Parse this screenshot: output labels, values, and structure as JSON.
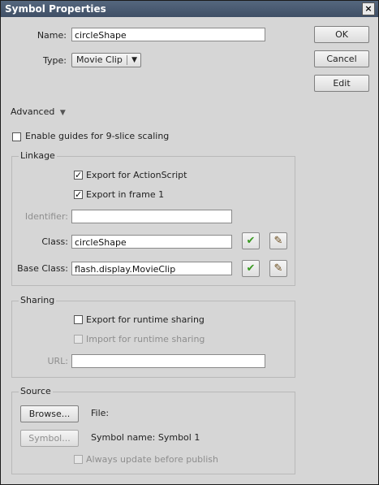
{
  "window": {
    "title": "Symbol Properties",
    "close_glyph": "×"
  },
  "name_row": {
    "label": "Name:",
    "value": "circleShape"
  },
  "type_row": {
    "label": "Type:",
    "value": "Movie Clip",
    "arrow": "▼"
  },
  "buttons": {
    "ok": "OK",
    "cancel": "Cancel",
    "edit": "Edit"
  },
  "advanced": {
    "label": "Advanced",
    "arrow": "▼"
  },
  "nine_slice": {
    "label": "Enable guides for 9-slice scaling",
    "checked": false
  },
  "linkage": {
    "legend": "Linkage",
    "export_actionscript": {
      "label": "Export for ActionScript",
      "checked": true,
      "mark": "✓"
    },
    "export_frame1": {
      "label": "Export in frame 1",
      "checked": true,
      "mark": "✓"
    },
    "identifier": {
      "label": "Identifier:",
      "value": ""
    },
    "class": {
      "label": "Class:",
      "value": "circleShape"
    },
    "base_class": {
      "label": "Base Class:",
      "value": "flash.display.MovieClip"
    },
    "check_glyph": "✔",
    "pencil_glyph": "✎"
  },
  "sharing": {
    "legend": "Sharing",
    "export_runtime": {
      "label": "Export for runtime sharing",
      "checked": false
    },
    "import_runtime": {
      "label": "Import for runtime sharing",
      "checked": false,
      "disabled": true
    },
    "url": {
      "label": "URL:",
      "value": ""
    }
  },
  "source": {
    "legend": "Source",
    "browse_button": "Browse...",
    "file_label": "File:",
    "symbol_button": "Symbol...",
    "symbol_name": "Symbol name: Symbol 1",
    "always_update": {
      "label": "Always update before publish",
      "checked": false,
      "disabled": true
    }
  },
  "colors": {
    "check_green": "#3a9a22",
    "titlebar": "#4a5b72",
    "dialog_bg": "#d6d6d6"
  },
  "icons": [
    "close-icon",
    "chevron-down-icon",
    "check-icon",
    "pencil-icon"
  ]
}
